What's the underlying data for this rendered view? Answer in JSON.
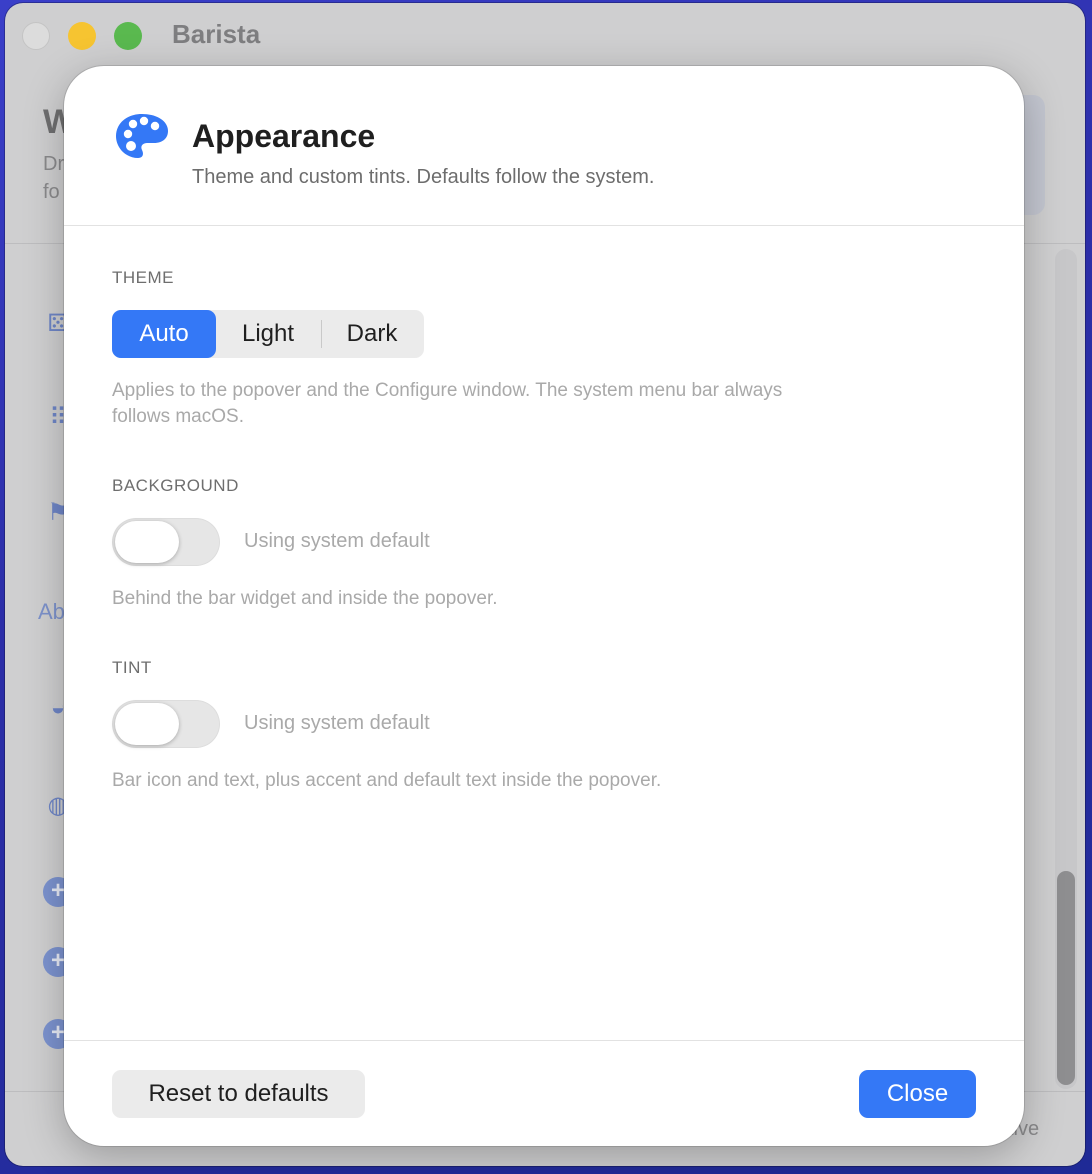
{
  "window": {
    "app_title": "Barista",
    "bg_heading": "W",
    "bg_desc_line1": "Dr",
    "bg_desc_line2": "fo",
    "bg_about": "Ab",
    "bg_status": "tive"
  },
  "dialog": {
    "title": "Appearance",
    "subtitle": "Theme and custom tints. Defaults follow the system.",
    "icon": "palette-icon",
    "accent_color": "#3478f6"
  },
  "theme": {
    "label": "THEME",
    "options": [
      "Auto",
      "Light",
      "Dark"
    ],
    "selected": "Auto",
    "help_line1": "Applies to the popover and the Configure window. The system menu bar always",
    "help_line2": "follows macOS."
  },
  "background": {
    "label": "BACKGROUND",
    "toggle_on": false,
    "toggle_label": "Using system default",
    "help": "Behind the bar widget and inside the popover."
  },
  "tint": {
    "label": "TINT",
    "toggle_on": false,
    "toggle_label": "Using system default",
    "help": "Bar icon and text, plus accent and default text inside the popover."
  },
  "footer": {
    "reset_label": "Reset to defaults",
    "close_label": "Close"
  }
}
